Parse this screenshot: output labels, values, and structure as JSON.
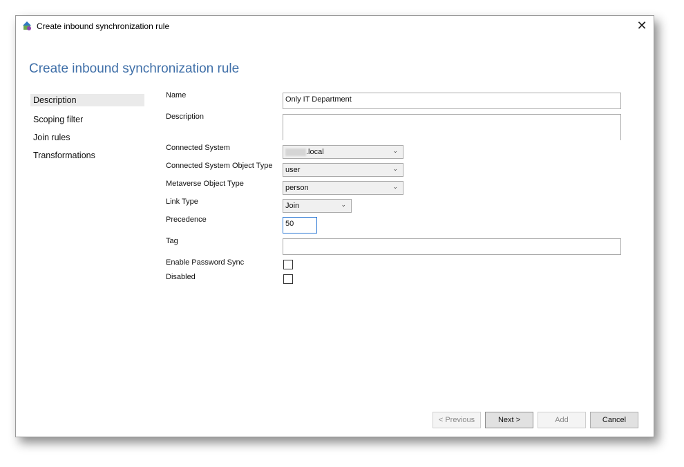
{
  "window": {
    "title": "Create inbound synchronization rule"
  },
  "header": {
    "title": "Create inbound synchronization rule"
  },
  "nav": {
    "items": [
      {
        "label": "Description"
      },
      {
        "label": "Scoping filter"
      },
      {
        "label": "Join rules"
      },
      {
        "label": "Transformations"
      }
    ]
  },
  "form": {
    "name": {
      "label": "Name",
      "value": "Only IT Department"
    },
    "description": {
      "label": "Description",
      "value": ""
    },
    "connected_system": {
      "label": "Connected System",
      "value": ".local"
    },
    "cs_object_type": {
      "label": "Connected System Object Type",
      "value": "user"
    },
    "mv_object_type": {
      "label": "Metaverse Object Type",
      "value": "person"
    },
    "link_type": {
      "label": "Link Type",
      "value": "Join"
    },
    "precedence": {
      "label": "Precedence",
      "value": "50"
    },
    "tag": {
      "label": "Tag",
      "value": ""
    },
    "enable_password_sync": {
      "label": "Enable Password Sync",
      "checked": false
    },
    "disabled": {
      "label": "Disabled",
      "checked": false
    }
  },
  "buttons": {
    "previous": "< Previous",
    "next": "Next >",
    "add": "Add",
    "cancel": "Cancel"
  },
  "icons": {
    "app": "sync-app-icon",
    "close": "close-icon",
    "dropdown": "chevron-down-icon"
  }
}
